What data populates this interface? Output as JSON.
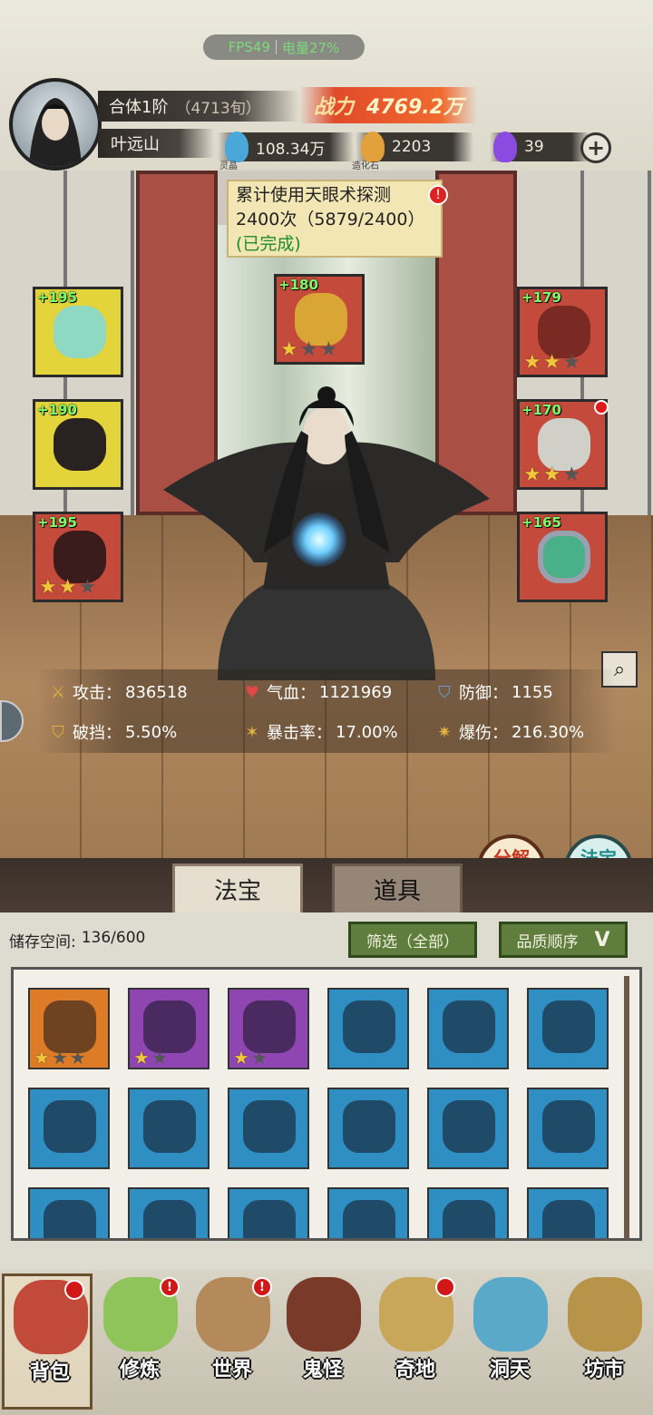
{
  "status": {
    "fps": "FPS49",
    "battery": "电量27%"
  },
  "player": {
    "rank": "合体1阶",
    "rank_time": "（4713旬）",
    "name": "叶远山"
  },
  "power": {
    "label": "战力",
    "value": "4769.2万"
  },
  "resources": [
    {
      "name": "灵晶",
      "value": "108.34万",
      "icon": "blue-crystal-icon",
      "color": "#4aa8d8"
    },
    {
      "name": "造化石",
      "value": "2203",
      "icon": "orange-stone-icon",
      "color": "#e2a13a"
    },
    {
      "name": "",
      "value": "39",
      "icon": "purple-flame-icon",
      "color": "#8a4ce0"
    }
  ],
  "task": {
    "text": "累计使用天眼术探测2400次（5879/2400）",
    "status": "(已完成)",
    "alert": "!"
  },
  "equipment": {
    "left": [
      {
        "bonus": "+195",
        "stars": 0,
        "max": 0,
        "color": "#e3d43b",
        "icon": "jade-mirror-icon"
      },
      {
        "bonus": "+190",
        "stars": 0,
        "max": 0,
        "color": "#e3d43b",
        "icon": "black-robe-icon"
      },
      {
        "bonus": "+195",
        "stars": 2,
        "max": 3,
        "color": "#c44a3c",
        "icon": "dark-boots-icon"
      }
    ],
    "center": {
      "bonus": "+180",
      "stars": 1,
      "max": 3,
      "color": "#c44a3c",
      "icon": "golden-cloud-icon"
    },
    "right": [
      {
        "bonus": "+179",
        "stars": 2,
        "max": 3,
        "color": "#c44a3c",
        "icon": "ruby-circlet-icon"
      },
      {
        "bonus": "+170",
        "stars": 2,
        "max": 3,
        "color": "#c44a3c",
        "icon": "silver-amulet-icon",
        "dot": true
      },
      {
        "bonus": "+165",
        "stars": 0,
        "max": 0,
        "color": "#c44a3c",
        "icon": "jade-ring-icon"
      }
    ]
  },
  "stats": [
    {
      "label": "攻击：",
      "value": "836518",
      "icon": "sword-icon"
    },
    {
      "label": "气血：",
      "value": "1121969",
      "icon": "heart-icon"
    },
    {
      "label": "防御：",
      "value": "1155",
      "icon": "shield-icon"
    },
    {
      "label": "破挡：",
      "value": "5.50%",
      "icon": "break-shield-icon"
    },
    {
      "label": "暴击率：",
      "value": "17.00%",
      "icon": "crit-icon"
    },
    {
      "label": "爆伤：",
      "value": "216.30%",
      "icon": "crit-damage-icon"
    }
  ],
  "round_buttons": {
    "decompose": "分解再造",
    "synthesize": "法宝合成"
  },
  "tabs": [
    "法宝",
    "道具"
  ],
  "storage": {
    "label": "储存空间:",
    "value": "136/600"
  },
  "filter_label": "筛选（全部）",
  "sort_label": "品质顺序",
  "sort_icon": "V",
  "inventory": [
    {
      "color": "#dd7b26",
      "stars": 1,
      "max": 3,
      "icon": "golden-cloud-icon"
    },
    {
      "color": "#8f46b3",
      "stars": 1,
      "max": 2,
      "icon": "dark-boots-icon"
    },
    {
      "color": "#8f46b3",
      "stars": 1,
      "max": 2,
      "icon": "ruby-circlet-icon"
    },
    {
      "color": "#2f8fc3",
      "stars": 0,
      "max": 0,
      "icon": "dark-dagger-icon"
    },
    {
      "color": "#2f8fc3",
      "stars": 0,
      "max": 0,
      "icon": "dark-dagger-icon"
    },
    {
      "color": "#2f8fc3",
      "stars": 0,
      "max": 0,
      "icon": "saw-blade-icon"
    },
    {
      "color": "#2f8fc3",
      "stars": 0,
      "max": 0,
      "icon": "ice-sword-icon"
    },
    {
      "color": "#2f8fc3",
      "stars": 0,
      "max": 0,
      "icon": "ice-sword-icon"
    },
    {
      "color": "#2f8fc3",
      "stars": 0,
      "max": 0,
      "icon": "ice-bow-icon"
    },
    {
      "color": "#2f8fc3",
      "stars": 0,
      "max": 0,
      "icon": "ice-bow-icon"
    },
    {
      "color": "#2f8fc3",
      "stars": 0,
      "max": 0,
      "icon": "jade-mirror-icon"
    },
    {
      "color": "#2f8fc3",
      "stars": 0,
      "max": 0,
      "icon": "golden-lotus-icon"
    },
    {
      "color": "#2f8fc3",
      "stars": 0,
      "max": 0,
      "icon": "beast-mask-icon"
    },
    {
      "color": "#2f8fc3",
      "stars": 0,
      "max": 0,
      "icon": "black-robe-icon"
    },
    {
      "color": "#2f8fc3",
      "stars": 0,
      "max": 0,
      "icon": "white-armor-icon"
    },
    {
      "color": "#2f8fc3",
      "stars": 0,
      "max": 0,
      "icon": "demon-helm-icon"
    },
    {
      "color": "#2f8fc3",
      "stars": 0,
      "max": 0,
      "icon": "demon-helm-icon"
    },
    {
      "color": "#2f8fc3",
      "stars": 0,
      "max": 0,
      "icon": "dark-coat-icon"
    }
  ],
  "nav": [
    {
      "label": "背包",
      "icon": "backpack-icon",
      "dot": true,
      "alert": false,
      "color": "#c24a3a",
      "active": true
    },
    {
      "label": "修炼",
      "icon": "cultivate-lotus-icon",
      "dot": false,
      "alert": true,
      "color": "#8fc45a"
    },
    {
      "label": "世界",
      "icon": "world-scroll-icon",
      "dot": false,
      "alert": true,
      "color": "#b48a5a"
    },
    {
      "label": "鬼怪",
      "icon": "ghost-egg-icon",
      "dot": false,
      "alert": false,
      "color": "#7a3a2a"
    },
    {
      "label": "奇地",
      "icon": "mystic-land-icon",
      "dot": true,
      "alert": false,
      "color": "#c9a75a"
    },
    {
      "label": "洞天",
      "icon": "cave-heaven-icon",
      "dot": false,
      "alert": false,
      "color": "#5aa9c9"
    },
    {
      "label": "坊市",
      "icon": "market-stall-icon",
      "dot": false,
      "alert": false,
      "color": "#b8934a"
    }
  ]
}
